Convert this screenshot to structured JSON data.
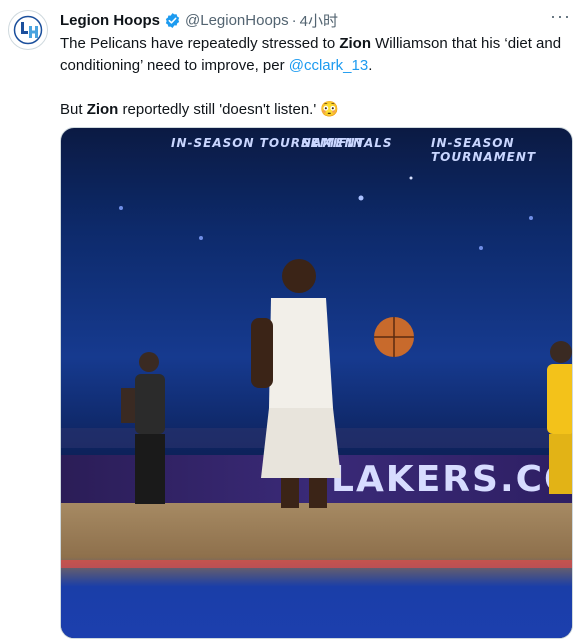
{
  "tweet": {
    "author_name": "Legion Hoops",
    "handle": "@LegionHoops",
    "separator": "·",
    "time": "4小时",
    "more_label": "···",
    "line1_pre": "The Pelicans have repeatedly stressed to ",
    "line1_bold": "Zion",
    "line1_post": " Williamson that his ‘diet and conditioning’ need to improve, per ",
    "mention": "@cclark_13",
    "line1_end": ".",
    "line2_pre": "But ",
    "line2_bold": "Zion",
    "line2_post": " reportedly still 'doesn't listen.' 😳"
  },
  "media": {
    "banner_left": "IN-SEASON TOURNAMENT",
    "banner_center": "SEMIFINALS",
    "banner_right": "IN-SEASON TOURNAMENT",
    "court_sign": "LAKERS.CO"
  },
  "colors": {
    "link": "#1d9bf0",
    "verified": "#1d9bf0",
    "muted": "#536471",
    "text": "#0f1419"
  },
  "icons": {
    "verified": "verified-badge-icon",
    "avatar": "legion-hoops-logo"
  }
}
